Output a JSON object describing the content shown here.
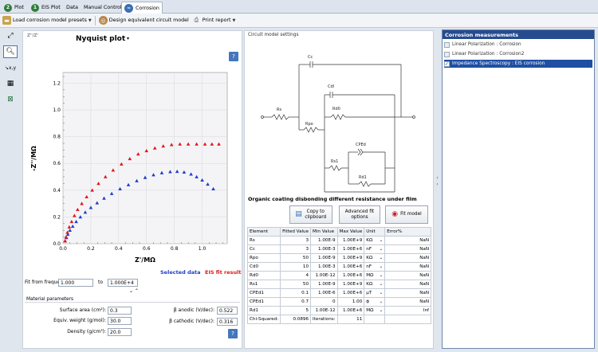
{
  "tabs": [
    {
      "badge": "2",
      "label": "Plot"
    },
    {
      "badge": "1",
      "label": "EIS Plot"
    },
    {
      "label": "Data"
    },
    {
      "label": "Manual Control"
    },
    {
      "label": "Corrosion"
    }
  ],
  "toolbar": {
    "load_presets": "Load corrosion model presets",
    "design_circuit": "Design equivalent circuit model",
    "print_report": "Print report"
  },
  "plot": {
    "axis_toggle": "Z''/Z'",
    "title": "Nyquist plot",
    "help": "?",
    "legend_selected": "Selected data",
    "legend_fit": "EIS fit result",
    "fit_from_label": "Fit from frequen",
    "fit_from_value": "1.000",
    "to_label": "to",
    "fit_to_value": "1.000E+4"
  },
  "chart_data": {
    "type": "scatter",
    "title": "Nyquist plot",
    "xlabel": "Z'/MΩ",
    "ylabel": "-Z''/MΩ",
    "xlim": [
      0,
      1.18
    ],
    "ylim": [
      0,
      1.28
    ],
    "xticks": [
      "0.0",
      "0.2",
      "0.4",
      "0.6",
      "0.8",
      "1.0"
    ],
    "yticks": [
      "0.0",
      "0.2",
      "0.4",
      "0.6",
      "0.8",
      "1.0",
      "1.2"
    ],
    "grid": true,
    "legend": "bottom-right",
    "series": [
      {
        "name": "Selected data",
        "color": "#1f3fc8",
        "marker": "triangle",
        "x": [
          0.016,
          0.025,
          0.035,
          0.05,
          0.07,
          0.095,
          0.125,
          0.16,
          0.2,
          0.245,
          0.295,
          0.35,
          0.41,
          0.47,
          0.53,
          0.59,
          0.65,
          0.71,
          0.77,
          0.82,
          0.87,
          0.92,
          0.96,
          1.0,
          1.04,
          1.08
        ],
        "y": [
          0.02,
          0.045,
          0.07,
          0.1,
          0.13,
          0.165,
          0.2,
          0.235,
          0.27,
          0.305,
          0.34,
          0.375,
          0.41,
          0.44,
          0.47,
          0.495,
          0.515,
          0.53,
          0.538,
          0.54,
          0.535,
          0.52,
          0.5,
          0.475,
          0.445,
          0.41
        ]
      },
      {
        "name": "EIS fit result",
        "color": "#e01818",
        "marker": "triangle",
        "x": [
          0.014,
          0.022,
          0.032,
          0.045,
          0.062,
          0.082,
          0.105,
          0.135,
          0.17,
          0.21,
          0.255,
          0.305,
          0.36,
          0.42,
          0.48,
          0.54,
          0.6,
          0.66,
          0.72,
          0.78,
          0.84,
          0.9,
          0.96,
          1.02,
          1.07,
          1.12
        ],
        "y": [
          0.02,
          0.05,
          0.085,
          0.125,
          0.165,
          0.21,
          0.255,
          0.3,
          0.35,
          0.4,
          0.45,
          0.5,
          0.55,
          0.595,
          0.635,
          0.67,
          0.695,
          0.715,
          0.73,
          0.74,
          0.745,
          0.745,
          0.745,
          0.745,
          0.745,
          0.745
        ]
      }
    ]
  },
  "material": {
    "title": "Material parameters",
    "surface_area_label": "Surface area (cm²):",
    "surface_area_value": "0.3",
    "equiv_weight_label": "Equiv. weight (g/mol):",
    "equiv_weight_value": "30.0",
    "density_label": "Density (g/cm³):",
    "density_value": "20.0",
    "beta_anodic_label": "β anodic (V/dec):",
    "beta_anodic_value": "0.522",
    "beta_cathodic_label": "β cathodic (V/dec):",
    "beta_cathodic_value": "0.316"
  },
  "circuit": {
    "settings_label": "Circuit model settings",
    "components": {
      "cc": "Cc",
      "rs": "Rs",
      "rpo": "Rpo",
      "cdl": "Cdl",
      "rct": "Rd0",
      "cpe": "CPEd",
      "rs1": "Rs1",
      "rd1": "Rd1"
    },
    "model_name": "Organic coating disbonding different resistance under film",
    "copy_label": "Copy to clipboard",
    "advanced_label": "Advanced fit options",
    "fit_label": "Fit model"
  },
  "fit_table": {
    "headers": [
      "Element",
      "Fitted Value",
      "Min Value",
      "Max Value",
      "Unit",
      "Error%"
    ],
    "rows": [
      [
        "Rs",
        "3",
        "1.00E-9",
        "1.00E+9",
        "KΩ",
        "NaN"
      ],
      [
        "Cc",
        "3",
        "1.00E-3",
        "1.00E+6",
        "nF",
        "NaN"
      ],
      [
        "Rpo",
        "50",
        "1.00E-9",
        "1.00E+9",
        "KΩ",
        "NaN"
      ],
      [
        "Cd0",
        "10",
        "1.00E-3",
        "1.00E+6",
        "nF",
        "NaN"
      ],
      [
        "Rd0",
        "4",
        "1.00E-12",
        "1.00E+6",
        "MΩ",
        "NaN"
      ],
      [
        "Rs1",
        "50",
        "1.00E-9",
        "1.00E+9",
        "KΩ",
        "NaN"
      ],
      [
        "CPEd1",
        "0.1",
        "1.00E-6",
        "1.00E+6",
        "μT",
        "NaN"
      ],
      [
        "CPEd1",
        "0.7",
        "0",
        "1.00",
        "ϕ",
        "NaN"
      ],
      [
        "Rd1",
        "5",
        "1.00E-12",
        "1.00E+6",
        "MΩ",
        "Inf"
      ]
    ],
    "chi_label": "Chi-Squared:",
    "chi_value": "0.0896",
    "iter_label": "Iterations:",
    "iter_value": "11"
  },
  "measurements": {
    "title": "Corrosion measurements",
    "items": [
      {
        "label": "Linear Polarization : Corrosion",
        "checked": false,
        "selected": false
      },
      {
        "label": "Linear Polarization : Corrosion2",
        "checked": false,
        "selected": false
      },
      {
        "label": "Impedance Spectroscopy : EIS corrosion",
        "checked": true,
        "selected": true
      }
    ]
  },
  "icons": {
    "collapse": "chevron-left-right",
    "zoom": "magnifier",
    "pan": "hand"
  }
}
